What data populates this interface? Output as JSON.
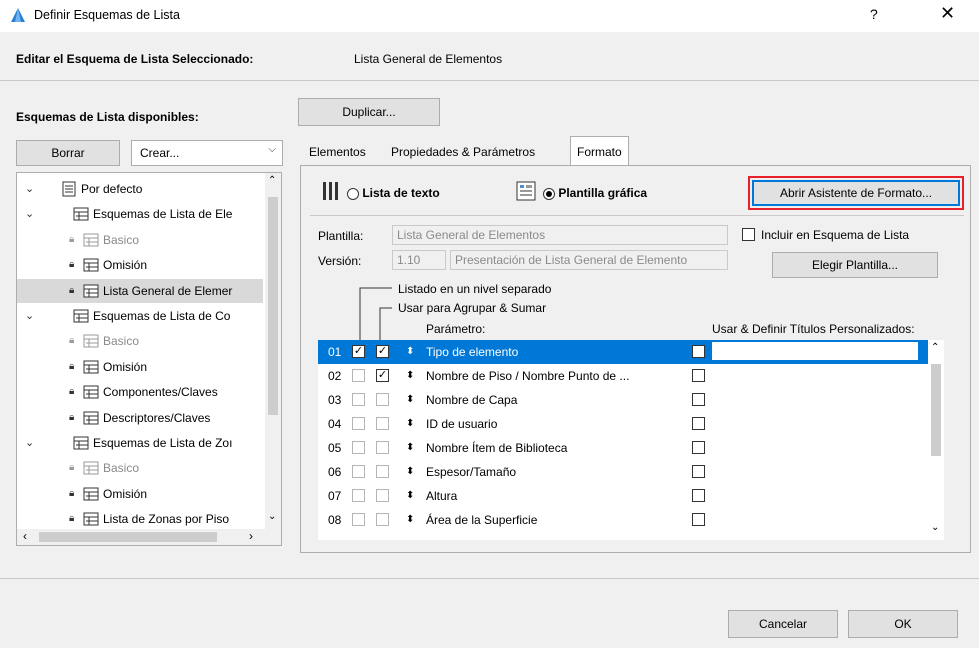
{
  "window": {
    "title": "Definir Esquemas de Lista",
    "help": "?",
    "close": "✕"
  },
  "header": {
    "label": "Editar el Esquema de Lista Seleccionado:",
    "value": "Lista General de Elementos"
  },
  "left": {
    "available_label": "Esquemas de Lista disponibles:",
    "delete_button": "Borrar",
    "create_combo": "Crear...",
    "tree": [
      {
        "label": "Por defecto",
        "level": 0,
        "chev": "⌄",
        "dim": false,
        "sel": false
      },
      {
        "label": "Esquemas de Lista de Ele",
        "level": 1,
        "chev": "⌄",
        "dim": false,
        "sel": false
      },
      {
        "label": "Basico",
        "level": 2,
        "dim": true,
        "sel": false
      },
      {
        "label": "Omisión",
        "level": 2,
        "dim": false,
        "sel": false
      },
      {
        "label": "Lista General de Elemer",
        "level": 2,
        "dim": false,
        "sel": true
      },
      {
        "label": "Esquemas de Lista de Co",
        "level": 1,
        "chev": "⌄",
        "dim": false,
        "sel": false
      },
      {
        "label": "Basico",
        "level": 2,
        "dim": true,
        "sel": false
      },
      {
        "label": "Omisión",
        "level": 2,
        "dim": false,
        "sel": false
      },
      {
        "label": "Componentes/Claves",
        "level": 2,
        "dim": false,
        "sel": false
      },
      {
        "label": "Descriptores/Claves",
        "level": 2,
        "dim": false,
        "sel": false
      },
      {
        "label": "Esquemas de Lista de Zoı",
        "level": 1,
        "chev": "⌄",
        "dim": false,
        "sel": false
      },
      {
        "label": "Basico",
        "level": 2,
        "dim": true,
        "sel": false
      },
      {
        "label": "Omisión",
        "level": 2,
        "dim": false,
        "sel": false
      },
      {
        "label": "Lista de Zonas por Piso",
        "level": 2,
        "dim": false,
        "sel": false
      }
    ]
  },
  "right": {
    "duplicate_button": "Duplicar...",
    "tabs": [
      "Elementos",
      "Propiedades & Parámetros",
      "Formato"
    ],
    "format": {
      "text_list": "Lista de texto",
      "graphic_template": "Plantilla gráfica",
      "open_wizard": "Abrir Asistente de Formato...",
      "template_label": "Plantilla:",
      "template_value": "Lista General de Elementos",
      "version_label": "Versión:",
      "version_value": "1.10",
      "version_desc": "Presentación de Lista General de Elemento",
      "include_label": "Incluir en Esquema de Lista",
      "choose_template": "Elegir Plantilla...",
      "separate_level": "Listado en un nivel separado",
      "group_sum": "Usar para Agrupar & Sumar",
      "param_header": "Parámetro:",
      "custom_titles_header": "Usar & Definir Títulos Personalizados:",
      "rows": [
        {
          "num": "01",
          "c1": "☑",
          "c2": "☑",
          "name": "Tipo de elemento"
        },
        {
          "num": "02",
          "c1": "",
          "c2": "☑",
          "name": "Nombre de Piso / Nombre Punto de ..."
        },
        {
          "num": "03",
          "c1": "",
          "c2": "",
          "name": "Nombre de Capa"
        },
        {
          "num": "04",
          "c1": "",
          "c2": "",
          "name": "ID de usuario"
        },
        {
          "num": "05",
          "c1": "",
          "c2": "",
          "name": "Nombre Ítem de Biblioteca"
        },
        {
          "num": "06",
          "c1": "",
          "c2": "",
          "name": "Espesor/Tamaño"
        },
        {
          "num": "07",
          "c1": "",
          "c2": "",
          "name": "Altura"
        },
        {
          "num": "08",
          "c1": "",
          "c2": "",
          "name": "Área de la Superficie"
        }
      ]
    }
  },
  "footer": {
    "cancel": "Cancelar",
    "ok": "OK"
  }
}
